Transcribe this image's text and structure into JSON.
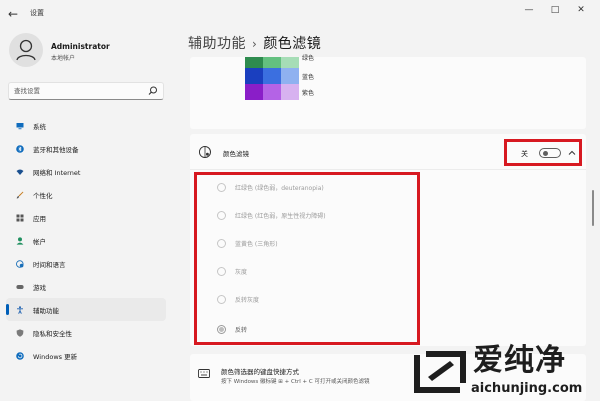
{
  "window": {
    "app_title": "设置",
    "back_glyph": "←",
    "min_glyph": "—",
    "max_glyph": "□",
    "close_glyph": "✕"
  },
  "profile": {
    "name": "Administrator",
    "account_type": "本地帐户"
  },
  "search": {
    "placeholder": "查找设置"
  },
  "sidebar": {
    "items": [
      {
        "label": "系统",
        "icon": "monitor-icon"
      },
      {
        "label": "蓝牙和其他设备",
        "icon": "bluetooth-icon"
      },
      {
        "label": "网络和 Internet",
        "icon": "wifi-icon"
      },
      {
        "label": "个性化",
        "icon": "brush-icon"
      },
      {
        "label": "应用",
        "icon": "apps-icon"
      },
      {
        "label": "帐户",
        "icon": "person-icon"
      },
      {
        "label": "时间和语言",
        "icon": "globe-clock-icon"
      },
      {
        "label": "游戏",
        "icon": "gamepad-icon"
      },
      {
        "label": "辅助功能",
        "icon": "accessibility-icon",
        "active": true
      },
      {
        "label": "隐私和安全性",
        "icon": "shield-icon"
      },
      {
        "label": "Windows 更新",
        "icon": "update-icon"
      }
    ]
  },
  "header": {
    "parent": "辅助功能",
    "separator": "›",
    "current": "颜色滤镜"
  },
  "color_preview": {
    "rows": [
      {
        "label": "绿色",
        "colors": [
          "#2e8b4e",
          "#63c07f",
          "#a6ddb6"
        ]
      },
      {
        "label": "蓝色",
        "colors": [
          "#1a3fbf",
          "#3b6fe0",
          "#8fb1f0"
        ]
      },
      {
        "label": "紫色",
        "colors": [
          "#8a1ec8",
          "#b463e6",
          "#d7b2f0"
        ]
      }
    ]
  },
  "color_filters": {
    "title": "颜色滤镜",
    "toggle_state_label": "关",
    "toggle_on": false,
    "options": [
      {
        "label": "红绿色 (绿色弱，deuteranopia)",
        "selected": false
      },
      {
        "label": "红绿色 (红色弱，原生性视力障碍)",
        "selected": false
      },
      {
        "label": "蓝黄色 (三角形)",
        "selected": false
      },
      {
        "label": "灰度",
        "selected": false
      },
      {
        "label": "反转灰度",
        "selected": false
      },
      {
        "label": "反转",
        "selected": true
      }
    ]
  },
  "keyboard_shortcut": {
    "title": "颜色筛选器的键盘快捷方式",
    "description": "按下 Windows 徽标键 ⊞ + Ctrl + C 可打开或关闭颜色滤镜"
  },
  "watermark": {
    "brand": "爱纯净",
    "url": "aichunjing.com"
  },
  "colors": {
    "accent": "#005fb8",
    "highlight_border": "#d71921",
    "background": "#f3f3f3",
    "card": "#fbfbfb"
  }
}
